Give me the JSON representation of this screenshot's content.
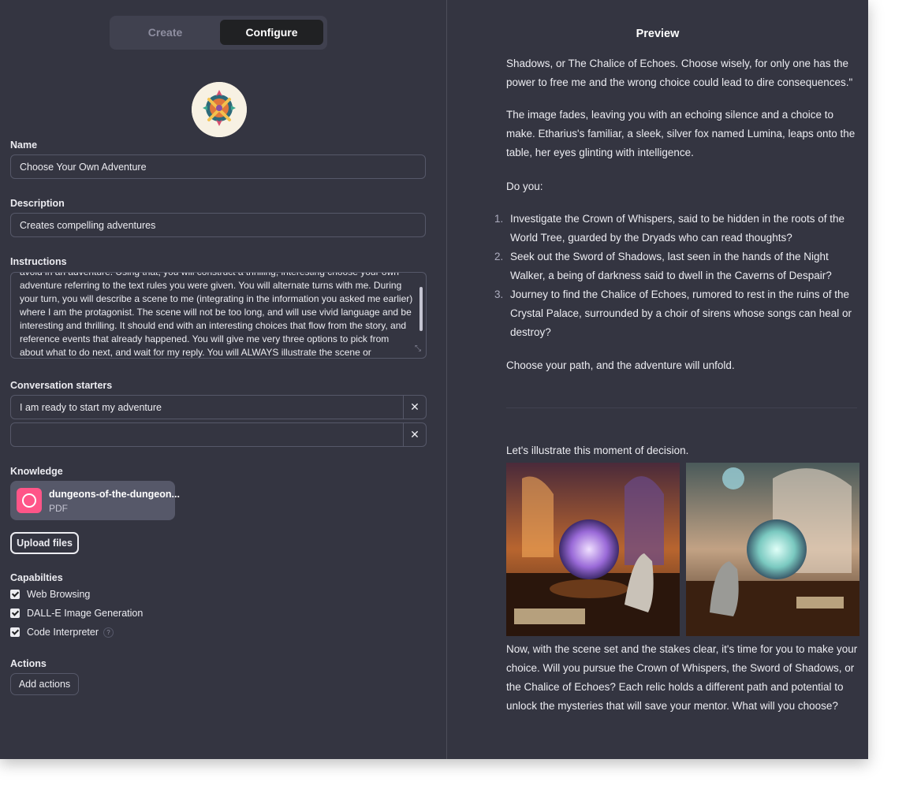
{
  "tabs": {
    "create": "Create",
    "configure": "Configure"
  },
  "name": {
    "label": "Name",
    "value": "Choose Your Own Adventure"
  },
  "description": {
    "label": "Description",
    "value": "Creates compelling adventures"
  },
  "instructions": {
    "label": "Instructions",
    "value": "avoid in an adventure. Using that, you will construct a thrilling, interesting choose your own adventure referring to the text rules you were given. You will alternate turns with me. During your turn, you will describe a scene to me (integrating in the information you asked me earlier) where I am the protagonist. The scene will not be too long, and will use vivid language and be interesting and thrilling. It should end with an interesting choices that flow from the story, and reference events that already happened. You will give me very three options to pick from about what to do next, and wait for my reply. You will  ALWAYS illustrate the scene or"
  },
  "conversation_starters": {
    "label": "Conversation starters",
    "items": [
      "I am ready to start my adventure",
      ""
    ]
  },
  "knowledge": {
    "label": "Knowledge",
    "file_name": "dungeons-of-the-dungeon...",
    "file_type": "PDF",
    "upload_label": "Upload files"
  },
  "capabilities": {
    "label": "Capabilties",
    "items": [
      "Web Browsing",
      "DALL-E Image Generation",
      "Code Interpreter"
    ],
    "help_glyph": "?"
  },
  "actions": {
    "label": "Actions",
    "button": "Add actions"
  },
  "close_glyph": "✕",
  "preview": {
    "title": "Preview",
    "p1": "Shadows, or The Chalice of Echoes. Choose wisely, for only one has the power to free me and the wrong choice could lead to dire consequences.\"",
    "p2": "The image fades, leaving you with an echoing silence and a choice to make. Etharius's familiar, a sleek, silver fox named Lumina, leaps onto the table, her eyes glinting with intelligence.",
    "p3": "Do you:",
    "options": [
      {
        "num": "1.",
        "text": "Investigate the Crown of Whispers, said to be hidden in the roots of the World Tree, guarded by the Dryads who can read thoughts?"
      },
      {
        "num": "2.",
        "text": "Seek out the Sword of Shadows, last seen in the hands of the Night Walker, a being of darkness said to dwell in the Caverns of Despair?"
      },
      {
        "num": "3.",
        "text": "Journey to find the Chalice of Echoes, rumored to rest in the ruins of the Crystal Palace, surrounded by a choir of sirens whose songs can heal or destroy?"
      }
    ],
    "p4": "Choose your path, and the adventure will unfold.",
    "p5": "Let's illustrate this moment of decision.",
    "p6": "Now, with the scene set and the stakes clear, it's time for you to make your choice. Will you pursue the Crown of Whispers, the Sword of Shadows, or the Chalice of Echoes? Each relic holds a different path and potential to unlock the mysteries that will save your mentor. What will you choose?"
  }
}
